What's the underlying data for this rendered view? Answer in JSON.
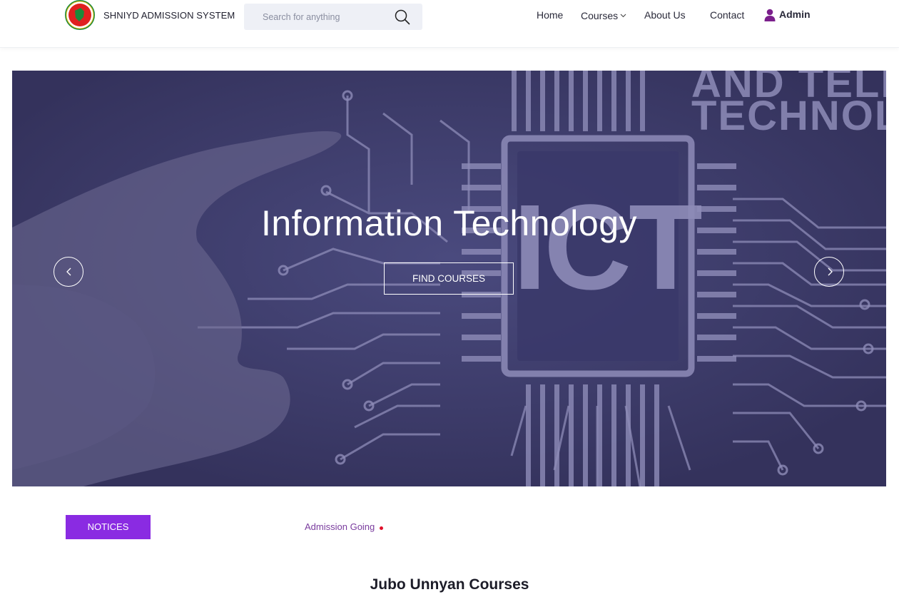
{
  "header": {
    "brand": "SHNIYD ADMISSION SYSTEM",
    "search_placeholder": "Search for anything",
    "nav": {
      "home": "Home",
      "courses": "Courses",
      "about": "About Us",
      "contact": "Contact",
      "admin": "Admin"
    }
  },
  "hero": {
    "title": "Information Technology",
    "button_label": "FIND COURSES",
    "bg_text_1": "AND TELEC",
    "bg_text_2": "TECHNOLO",
    "chip_text": "ICT"
  },
  "notices": {
    "label": "NOTICES",
    "ticker": "Admission Going"
  },
  "section": {
    "title": "Jubo Unnyan Courses"
  },
  "colors": {
    "accent": "#8a2be2",
    "hero_overlay": "#3d3b6a",
    "ticker": "#7a3c9e",
    "dot": "#e0102a"
  }
}
